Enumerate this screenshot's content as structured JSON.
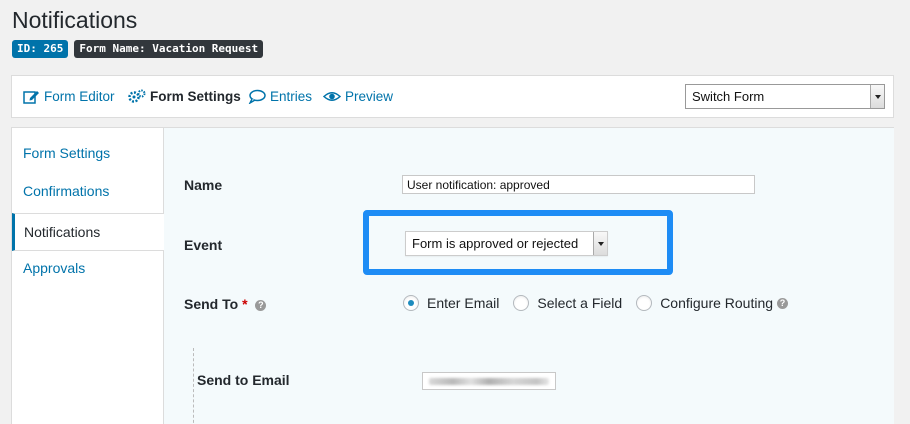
{
  "header": {
    "title": "Notifications",
    "id_badge": "ID: 265",
    "form_badge": "Form Name: Vacation Request"
  },
  "toolbar": {
    "items": [
      {
        "label": "Form Editor",
        "icon": "edit-icon"
      },
      {
        "label": "Form Settings",
        "icon": "gears-icon"
      },
      {
        "label": "Entries",
        "icon": "speech-bubble-icon"
      },
      {
        "label": "Preview",
        "icon": "eye-icon"
      }
    ],
    "switch_form": "Switch Form"
  },
  "sidebar": {
    "items": [
      {
        "label": "Form Settings"
      },
      {
        "label": "Confirmations"
      },
      {
        "label": "Notifications"
      },
      {
        "label": "Approvals"
      }
    ]
  },
  "form": {
    "name_label": "Name",
    "name_value": "User notification: approved",
    "event_label": "Event",
    "event_value": "Form is approved or rejected",
    "send_to_label": "Send To",
    "send_to_required": "*",
    "send_to_options": [
      "Enter Email",
      "Select a Field",
      "Configure Routing"
    ],
    "send_to_selected": "Enter Email",
    "send_to_email_label": "Send to Email"
  },
  "colors": {
    "accent": "#0073aa",
    "highlight": "#1e8cf5",
    "content_bg": "#f4fafc"
  }
}
